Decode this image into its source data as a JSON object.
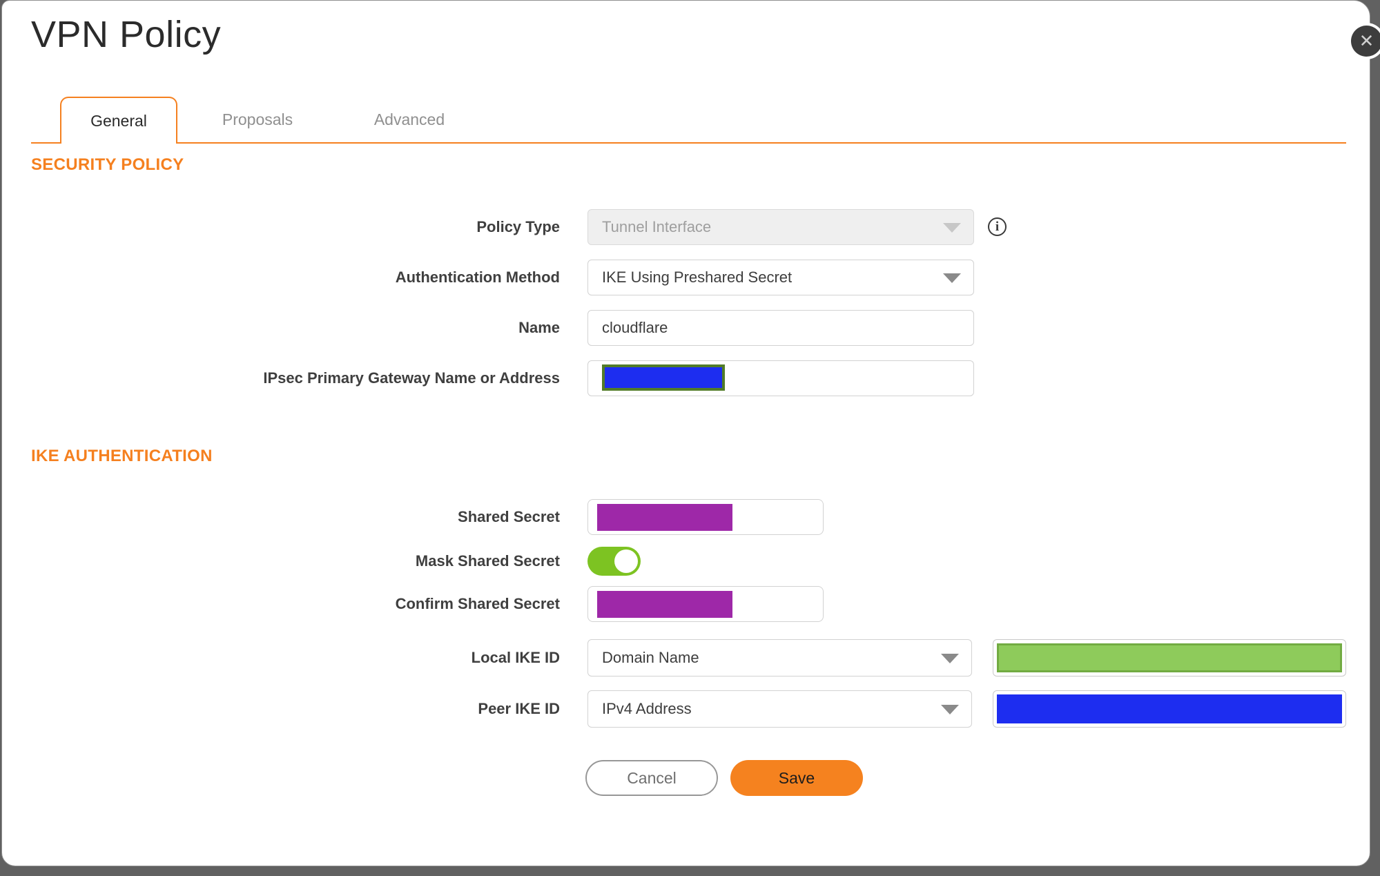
{
  "colors": {
    "accent": "#f5801f",
    "title-color": "#2b2b2b",
    "label-color": "#3f3f3f",
    "blue-redact": "#1d2df0",
    "purple-redact": "#9e28a8",
    "olive-border": "#527c28",
    "green-fill": "#8ecb5b",
    "green-border": "#72ab42",
    "toggle-green": "#7dc322",
    "save-orange": "#f5821f"
  },
  "dialog": {
    "title": "VPN Policy"
  },
  "icons": {
    "close": "✕",
    "info": "i"
  },
  "tabs": {
    "general": "General",
    "proposals": "Proposals",
    "advanced": "Advanced"
  },
  "sections": {
    "security": "SECURITY POLICY",
    "ike": "IKE AUTHENTICATION"
  },
  "fields": {
    "policy_type": {
      "label": "Policy Type",
      "value": "Tunnel Interface",
      "disabled": true
    },
    "auth_method": {
      "label": "Authentication Method",
      "value": "IKE Using Preshared Secret"
    },
    "name": {
      "label": "Name",
      "value": "cloudflare"
    },
    "gateway": {
      "label": "IPsec Primary Gateway Name or Address",
      "value_redacted": true
    },
    "shared_secret": {
      "label": "Shared Secret",
      "value_redacted": true
    },
    "mask_shared_secret": {
      "label": "Mask Shared Secret",
      "state": "on"
    },
    "confirm_shared_secret": {
      "label": "Confirm Shared Secret",
      "value_redacted": true
    },
    "local_ike_id": {
      "label": "Local IKE ID",
      "value": "Domain Name",
      "id_value_redacted": true
    },
    "peer_ike_id": {
      "label": "Peer IKE ID",
      "value": "IPv4 Address",
      "id_value_redacted": true
    }
  },
  "buttons": {
    "cancel": "Cancel",
    "save": "Save"
  }
}
